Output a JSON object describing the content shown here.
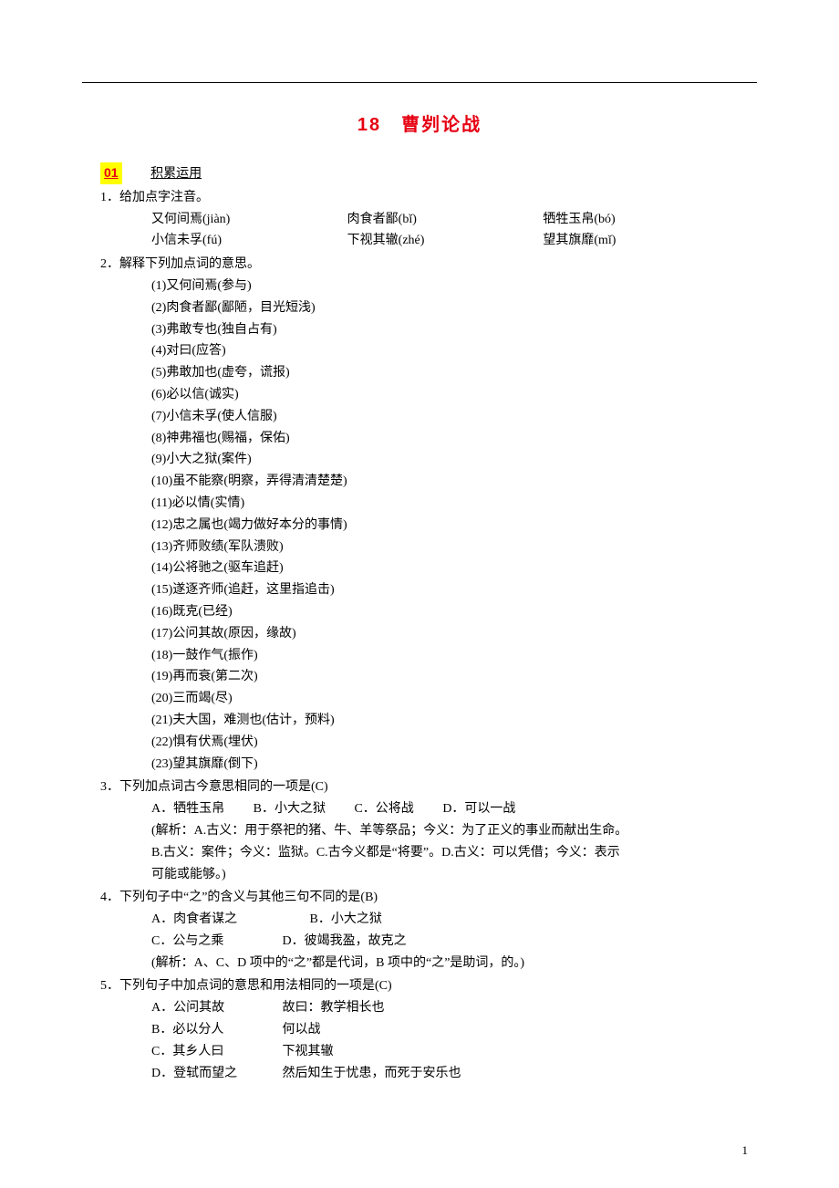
{
  "title": "18　曹刿论战",
  "section_tag": "01",
  "section_label": "积累运用",
  "q1": {
    "stem": "1．给加点字注音。",
    "r1a": "又何间焉(jiàn)",
    "r1b": "肉食者鄙(bǐ)",
    "r1c": "牺牲玉帛(bó)",
    "r2a": "小信未孚(fú)",
    "r2b": "下视其辙(zhé)",
    "r2c": "望其旗靡(mǐ)"
  },
  "q2": {
    "stem": "2．解释下列加点词的意思。",
    "items": [
      "(1)又何间焉(参与)",
      "(2)肉食者鄙(鄙陋，目光短浅)",
      "(3)弗敢专也(独自占有)",
      "(4)对曰(应答)",
      "(5)弗敢加也(虚夸，谎报)",
      "(6)必以信(诚实)",
      "(7)小信未孚(使人信服)",
      "(8)神弗福也(赐福，保佑)",
      "(9)小大之狱(案件)",
      "(10)虽不能察(明察，弄得清清楚楚)",
      "(11)必以情(实情)",
      "(12)忠之属也(竭力做好本分的事情)",
      "(13)齐师败绩(军队溃败)",
      "(14)公将驰之(驱车追赶)",
      "(15)遂逐齐师(追赶，这里指追击)",
      "(16)既克(已经)",
      "(17)公问其故(原因，缘故)",
      "(18)一鼓作气(振作)",
      "(19)再而衰(第二次)",
      "(20)三而竭(尽)",
      "(21)夫大国，难测也(估计，预料)",
      "(22)惧有伏焉(埋伏)",
      "(23)望其旗靡(倒下)"
    ]
  },
  "q3": {
    "stem": "3．下列加点词古今意思相同的一项是(C)",
    "opts": {
      "a": "A．牺牲玉帛",
      "b": "B．小大之狱",
      "c": "C．公将战",
      "d": "D．可以一战"
    },
    "exp1": "(解析：A.古义：用于祭祀的猪、牛、羊等祭品；今义：为了正义的事业而献出生命。",
    "exp2": "B.古义：案件；今义：监狱。C.古今义都是“将要”。D.古义：可以凭借；今义：表示",
    "exp3": "可能或能够。)"
  },
  "q4": {
    "stem": "4．下列句子中“之”的含义与其他三句不同的是(B)",
    "a": "A．肉食者谋之",
    "b": "B．小大之狱",
    "c": "C．公与之乘",
    "d": "D．彼竭我盈，故克之",
    "exp": "(解析：A、C、D 项中的“之”都是代词，B 项中的“之”是助词，的。)"
  },
  "q5": {
    "stem": "5．下列句子中加点词的意思和用法相同的一项是(C)",
    "a1": "A．公问其故",
    "a2": "故曰：教学相长也",
    "b1": "B．必以分人",
    "b2": "何以战",
    "c1": "C．其乡人曰",
    "c2": "下视其辙",
    "d1": "D．登轼而望之",
    "d2": "然后知生于忧患，而死于安乐也"
  },
  "page_num": "1"
}
